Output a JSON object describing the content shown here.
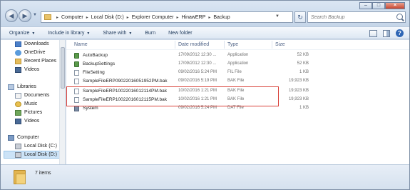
{
  "address": {
    "crumbs": [
      "Computer",
      "Local Disk (D:)",
      "Explorer Computer",
      "HinawERP",
      "Backup"
    ]
  },
  "search": {
    "placeholder": "Search Backup"
  },
  "toolbar": {
    "organize": "Organize",
    "include_in_library": "Include in library",
    "share_with": "Share with",
    "burn": "Burn",
    "new_folder": "New folder"
  },
  "navigation": {
    "favorites": [
      {
        "label": "Downloads",
        "icon": "downloads-icon"
      },
      {
        "label": "OneDrive",
        "icon": "onedrive-icon"
      },
      {
        "label": "Recent Places",
        "icon": "recent-places-icon"
      },
      {
        "label": "Videos",
        "icon": "videos-icon"
      }
    ],
    "libraries_label": "Libraries",
    "libraries": [
      {
        "label": "Documents",
        "icon": "documents-icon"
      },
      {
        "label": "Music",
        "icon": "music-icon"
      },
      {
        "label": "Pictures",
        "icon": "pictures-icon"
      },
      {
        "label": "Videos",
        "icon": "videos-icon"
      }
    ],
    "computer_label": "Computer",
    "drives": [
      {
        "label": "Local Disk (C:)",
        "icon": "drive-icon"
      },
      {
        "label": "Local Disk (D:)",
        "icon": "drive-icon",
        "selected": true
      }
    ]
  },
  "columns": {
    "name": "Name",
    "date_modified": "Date modified",
    "type": "Type",
    "size": "Size"
  },
  "files": [
    {
      "name": "AutoBackup",
      "date": "17/09/2012 12:30 ...",
      "type": "Application",
      "size": "52 KB",
      "icon": "application-icon"
    },
    {
      "name": "BackupSettings",
      "date": "17/09/2012 12:30 ...",
      "type": "Application",
      "size": "52 KB",
      "icon": "application-icon"
    },
    {
      "name": "FileSetting",
      "date": "09/02/2016 5:24 PM",
      "type": "FIL File",
      "size": "1 KB",
      "icon": "file-icon"
    },
    {
      "name": "SampleFileERP09022016051952PM.bak",
      "date": "09/02/2016 5:19 PM",
      "type": "BAK File",
      "size": "19,923 KB",
      "icon": "file-icon"
    },
    {
      "name": "SampleFileERP10022016012114PM.bak",
      "date": "10/02/2016 1:21 PM",
      "type": "BAK File",
      "size": "19,923 KB",
      "icon": "file-icon"
    },
    {
      "name": "SampleFileERP10022016012115PM.bak",
      "date": "10/02/2016 1:21 PM",
      "type": "BAK File",
      "size": "19,923 KB",
      "icon": "file-icon"
    },
    {
      "name": "System",
      "date": "09/02/2016 5:24 PM",
      "type": "DAT File",
      "size": "1 KB",
      "icon": "system-file-icon"
    }
  ],
  "status": {
    "item_count": "7 items"
  },
  "colors": {
    "highlight_border": "#d9423a",
    "selection": "#cce3f7"
  }
}
